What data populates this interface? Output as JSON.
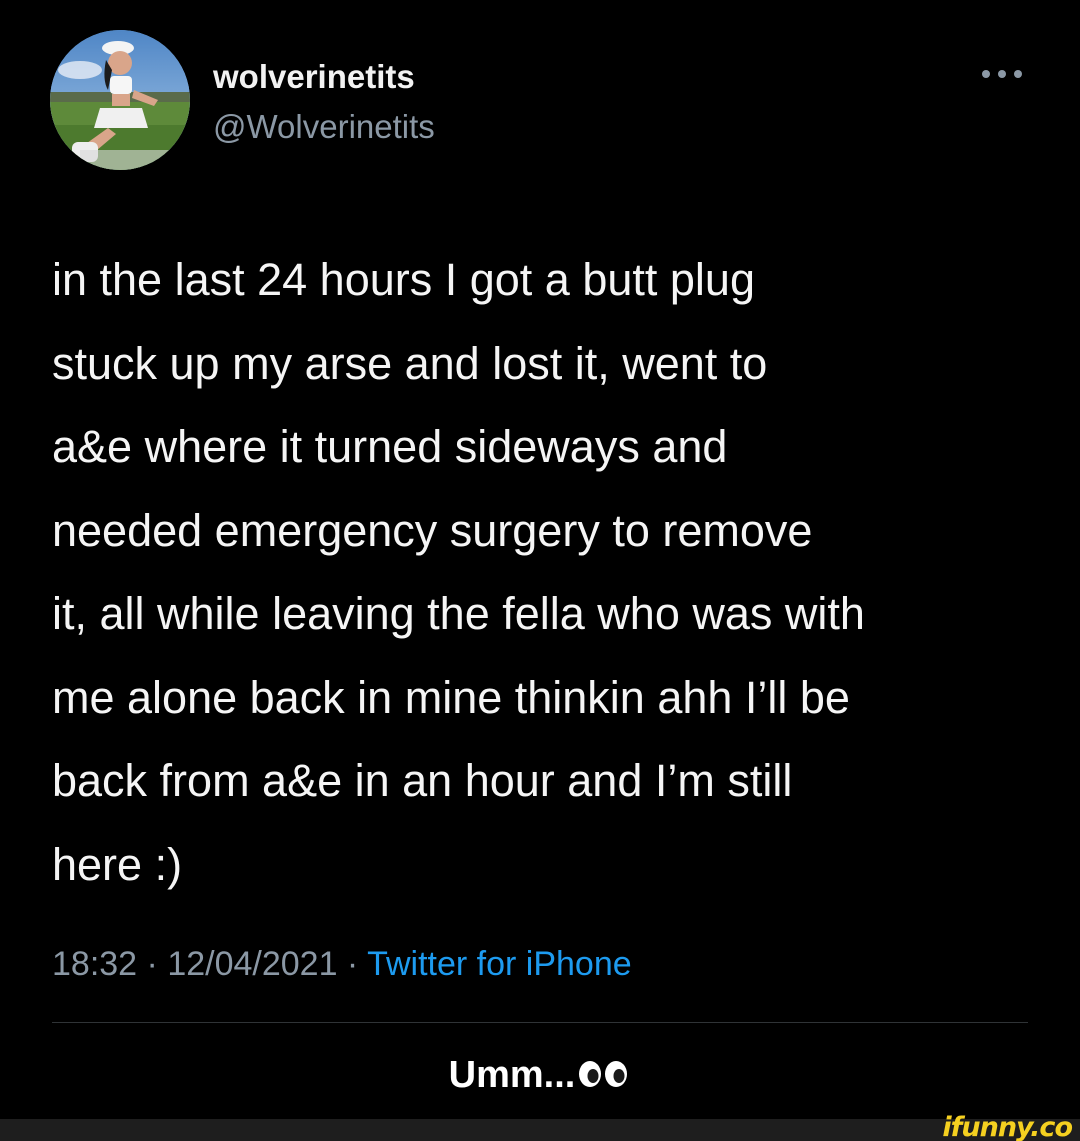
{
  "user": {
    "display_name": "wolverinetits",
    "handle": "@Wolverinetits"
  },
  "tweet": {
    "text": "in the last 24 hours I got a butt plug\nstuck up my arse and lost it, went to\na&e where it turned sideways and\nneeded emergency surgery to remove\nit, all while leaving the fella who was with\nme alone back in mine thinkin ahh I’ll be\nback from a&e in an hour and I’m still\nhere :)",
    "time": "18:32",
    "date": "12/04/2021",
    "separator": " · ",
    "source": "Twitter for iPhone"
  },
  "caption": {
    "text": "Umm..."
  },
  "watermark": {
    "text": "ifunny.co"
  },
  "icons": {
    "more": "more-options-icon",
    "eyes": "eyes-emoji-icon"
  },
  "colors": {
    "background": "#000000",
    "text": "#f5f5f5",
    "muted": "#8b98a5",
    "link": "#1d9bf0",
    "watermark": "#f5d020"
  }
}
